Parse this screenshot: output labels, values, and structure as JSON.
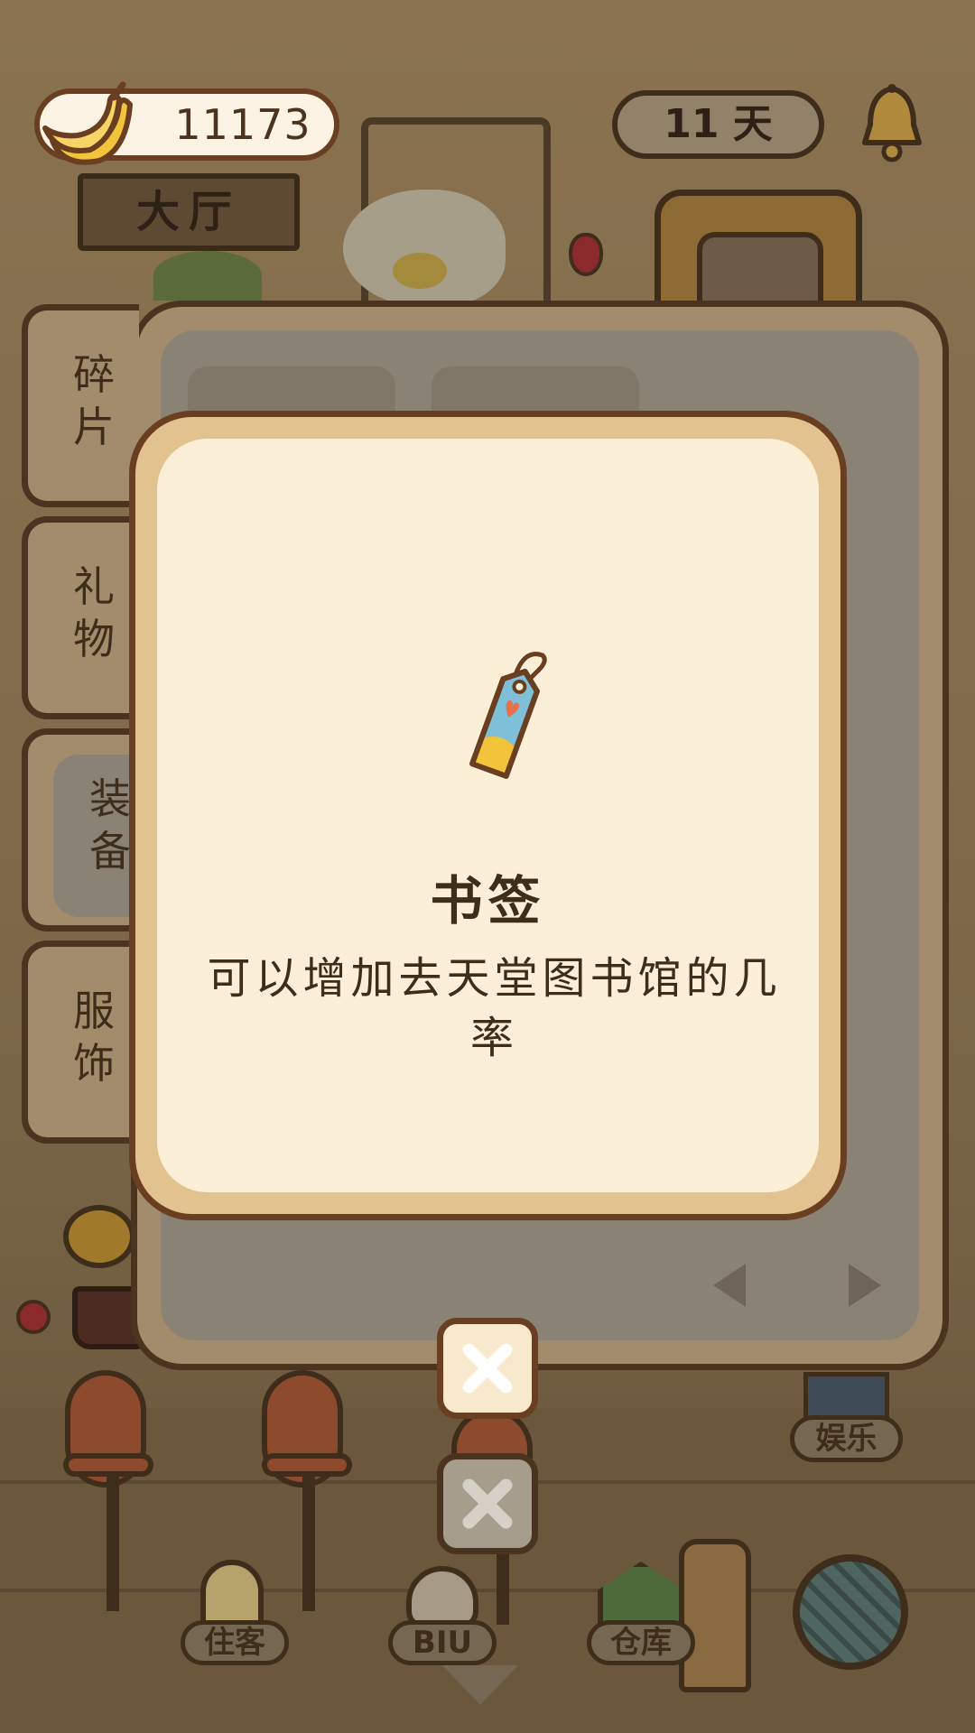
{
  "hud": {
    "banana_count": "11173",
    "days": "11 天",
    "location": "大厅"
  },
  "tabs": [
    {
      "label": "碎\n片",
      "active": false
    },
    {
      "label": "礼\n物",
      "active": false
    },
    {
      "label": "装\n备",
      "active": true
    },
    {
      "label": "服\n饰",
      "active": false
    }
  ],
  "popup": {
    "item_name": "书签",
    "item_description": "可以增加去天堂图书馆的几率",
    "item_icon": "bookmark-tag-icon"
  },
  "bottom_nav": {
    "guests": "住客",
    "biu": "BIU",
    "warehouse": "仓库",
    "entertainment": "娱乐"
  },
  "colors": {
    "popup_border": "#6a3e20",
    "popup_frame": "#e2c28e",
    "popup_bg": "#fcefd8",
    "text_dark": "#3e2d1a"
  }
}
